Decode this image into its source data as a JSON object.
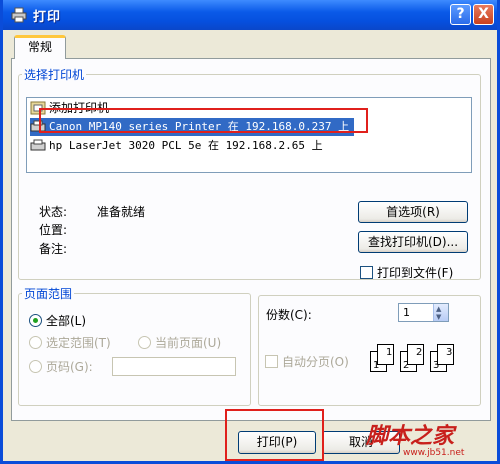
{
  "window": {
    "title": "打印",
    "help": "?",
    "close": "X"
  },
  "tabs": [
    {
      "label": "常规"
    }
  ],
  "printer_group": {
    "legend": "选择打印机",
    "printers": [
      {
        "name": "添加打印机"
      },
      {
        "name": "Canon MP140 series Printer 在 192.168.0.237 上"
      },
      {
        "name": "hp LaserJet 3020 PCL 5e 在 192.168.2.65 上"
      }
    ],
    "status_label": "状态:",
    "status_value": "准备就绪",
    "location_label": "位置:",
    "comment_label": "备注:",
    "preferences_button": "首选项(R)",
    "find_button": "查找打印机(D)...",
    "print_to_file_label": "打印到文件(F)"
  },
  "page_range": {
    "legend": "页面范围",
    "all": "全部(L)",
    "selection": "选定范围(T)",
    "current": "当前页面(U)",
    "pages": "页码(G):"
  },
  "copies": {
    "label": "份数(C):",
    "value": "1",
    "collate_label": "自动分页(O)",
    "pages_icons": [
      "1",
      "1",
      "2",
      "2",
      "3",
      "3"
    ]
  },
  "footer": {
    "print_button": "打印(P)",
    "cancel_button": "取消"
  },
  "watermark": {
    "text": "脚本之家",
    "url": "www.jb51.net"
  },
  "colors": {
    "highlight": "#316AC5",
    "annotation": "#E0201C"
  }
}
